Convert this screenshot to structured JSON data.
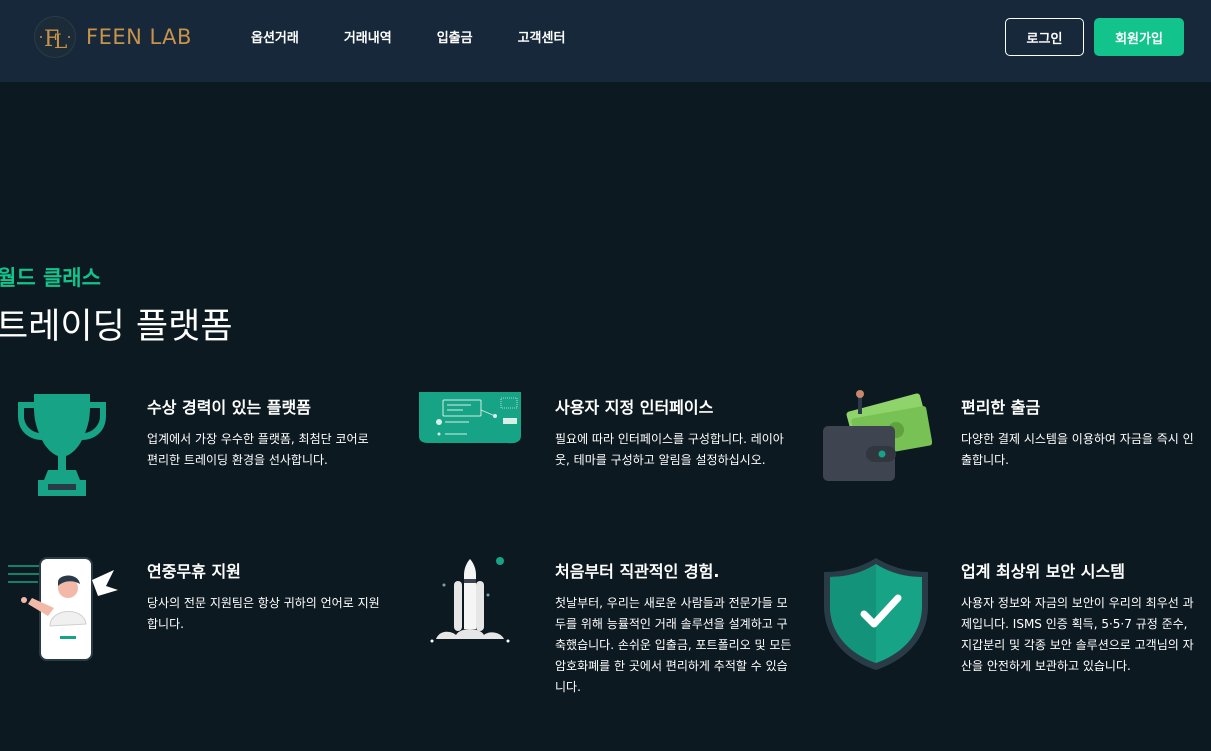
{
  "header": {
    "logo_text": "FEEN LAB",
    "logo_monogram": "FL",
    "nav": [
      "옵션거래",
      "거래내역",
      "입출금",
      "고객센터"
    ],
    "login_label": "로그인",
    "signup_label": "회원가입"
  },
  "section": {
    "kicker": "월드 클래스",
    "title": "트레이딩 플랫폼"
  },
  "features": [
    {
      "icon": "trophy-icon",
      "title": "수상 경력이 있는 플랫폼",
      "desc": "업계에서 가장 우수한 플랫폼, 최첨단 코어로 편리한 트레이딩 환경을 선사합니다."
    },
    {
      "icon": "interface-panel-icon",
      "title": "사용자 지정 인터페이스",
      "desc": "필요에 따라 인터페이스를 구성합니다. 레이아웃, 테마를 구성하고 알림을 설정하십시오."
    },
    {
      "icon": "wallet-icon",
      "title": "편리한 출금",
      "desc": "다양한 결제 시스템을 이용하여 자금을 즉시 인출합니다."
    },
    {
      "icon": "support-phone-icon",
      "title": "연중무휴 지원",
      "desc": "당사의 전문 지원팀은 항상 귀하의 언어로 지원합니다."
    },
    {
      "icon": "rocket-icon",
      "title": "처음부터 직관적인 경험.",
      "desc": "첫날부터, 우리는 새로운 사람들과 전문가들 모두를 위해 능률적인 거래 솔루션을 설계하고 구축했습니다. 손쉬운 입출금, 포트폴리오 및 모든 암호화폐를 한 곳에서 편리하게 추적할 수 있습니다."
    },
    {
      "icon": "shield-check-icon",
      "title": "업계 최상위 보안 시스템",
      "desc": "사용자 정보와 자금의 보안이 우리의 최우선 과제입니다. ISMS 인증 획득, 5·5·7 규정 준수, 지갑분리 및 각종 보안 솔루션으로 고객님의 자산을 안전하게 보관하고 있습니다."
    }
  ],
  "colors": {
    "accent": "#12c48b",
    "background": "#0d1921",
    "header": "#16283a",
    "logo": "#c8924a"
  }
}
